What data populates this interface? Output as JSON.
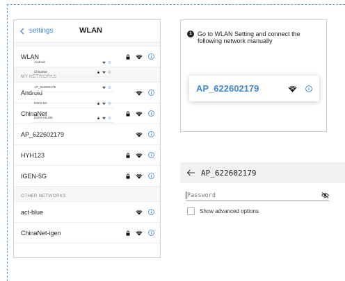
{
  "phone": {
    "back_label": "settings",
    "title": "WLAN",
    "wlan_row": {
      "label": "WLAN",
      "locked": true
    },
    "my_networks_header": "MY NETWORKS",
    "my_networks": [
      {
        "name": "Android",
        "locked": false
      },
      {
        "name": "ChinaNet",
        "locked": true
      },
      {
        "name": "AP_622602179",
        "locked": false
      },
      {
        "name": "HYH123",
        "locked": true
      },
      {
        "name": "IGEN-5G",
        "locked": true
      }
    ],
    "other_networks_header": "OTHER  NETWORKS",
    "other_networks": [
      {
        "name": "act-blue",
        "locked": false
      },
      {
        "name": "ChinaNet-igen",
        "locked": true
      }
    ]
  },
  "guide": {
    "step_number": "1",
    "instruction": "Go to WLAN Setting and connect the following network manually",
    "mini_list": [
      {
        "name": "Android",
        "locked": false
      },
      {
        "name": "ChinaNet",
        "locked": true
      },
      {
        "name": "AP_622602179",
        "locked": false
      },
      {
        "name": "IGEN-5G",
        "locked": true
      },
      {
        "name": "IGEN-HILINK",
        "locked": true
      }
    ],
    "highlight": "AP_622602179"
  },
  "dialog": {
    "title": "AP_622602179",
    "password_placeholder": "Password",
    "password_value": "",
    "advanced_label": "Show advanced options",
    "advanced_checked": false
  },
  "icons": {
    "back": "chevron-left-icon",
    "lock": "lock-icon",
    "wifi": "wifi-icon",
    "info": "info-icon",
    "eye": "eye-off-icon",
    "arrow": "arrow-left-icon"
  },
  "colors": {
    "accent": "#3f86d4",
    "frame_dash": "#5aa7dc",
    "section_bg": "#f7f7f7",
    "dialog_header_bg": "#f1f1f1"
  }
}
